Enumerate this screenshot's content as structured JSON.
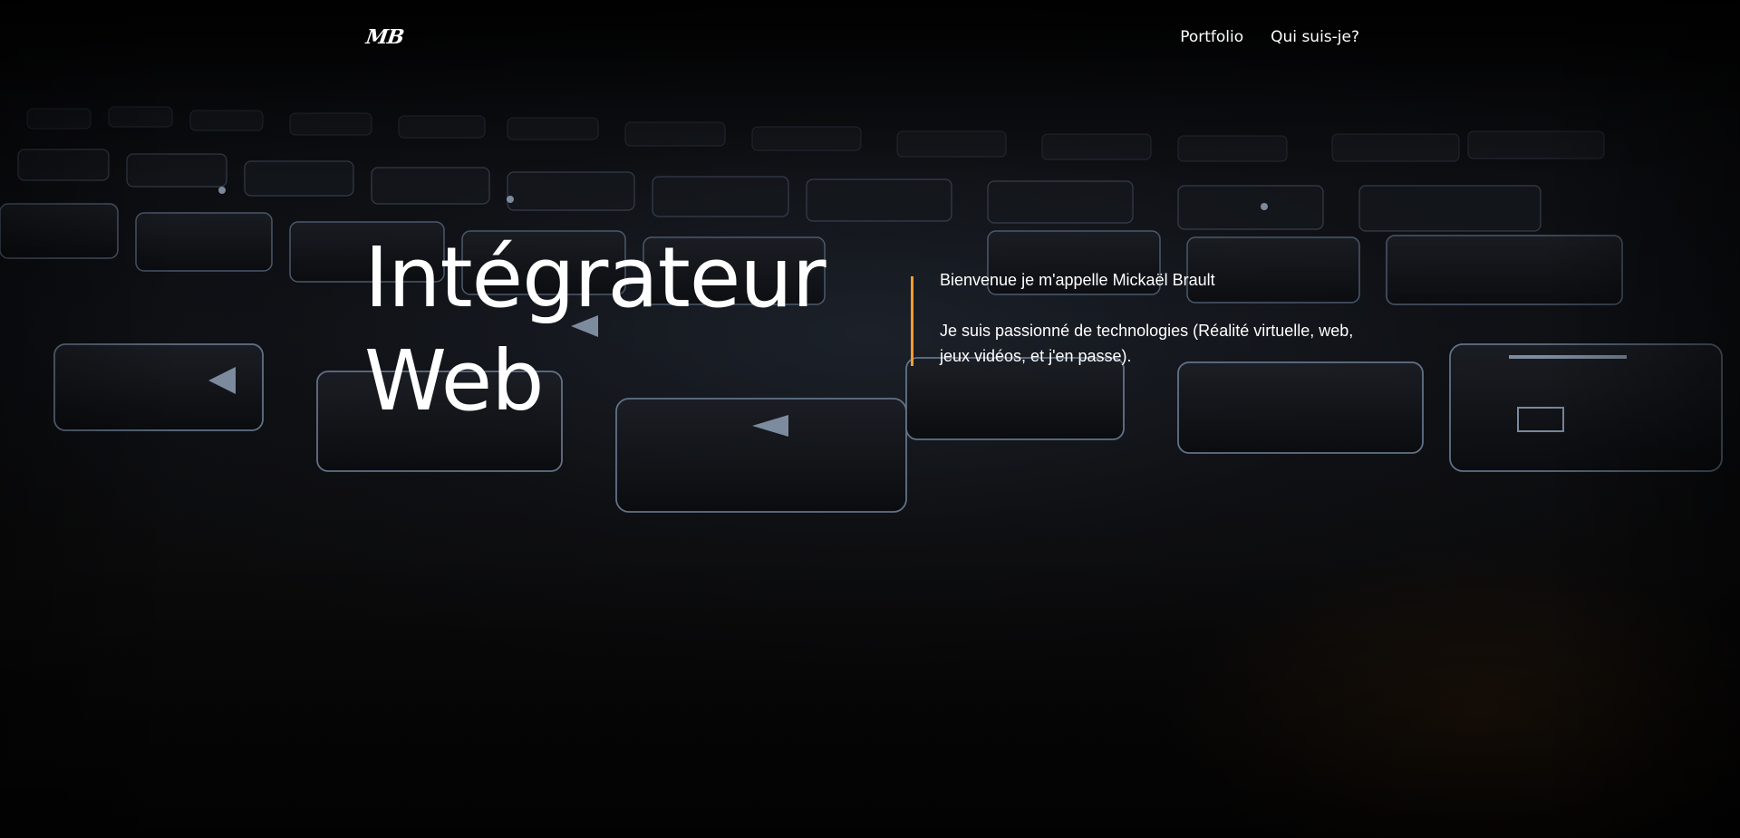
{
  "header": {
    "logo": "MB",
    "nav": [
      {
        "label": "Portfolio"
      },
      {
        "label": "Qui suis-je?"
      }
    ]
  },
  "hero": {
    "title_line1": "Intégrateur",
    "title_line2": "Web",
    "intro_line1": "Bienvenue je m'appelle Mickaël Brault",
    "intro_line2": "Je suis passionné de technologies (Réalité virtuelle, web, jeux vidéos, et j'en passe).",
    "accent_color": "#f39c34"
  }
}
